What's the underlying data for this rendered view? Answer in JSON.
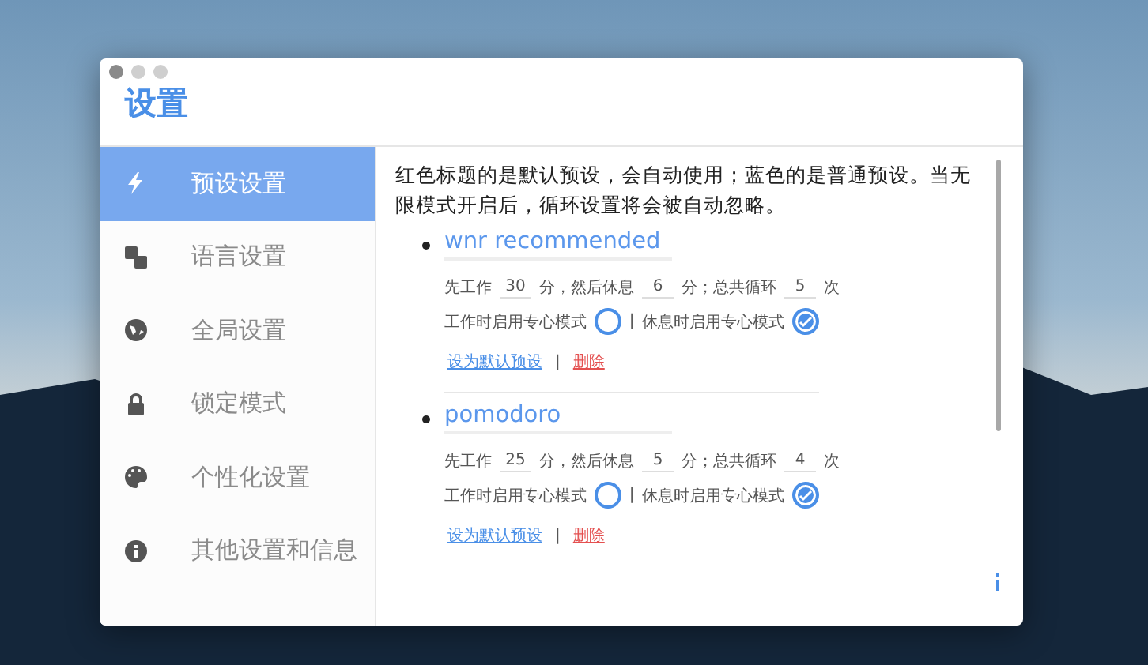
{
  "window": {
    "title": "设置"
  },
  "sidebar": {
    "items": [
      {
        "label": "预设设置",
        "selected": true
      },
      {
        "label": "语言设置",
        "selected": false
      },
      {
        "label": "全局设置",
        "selected": false
      },
      {
        "label": "锁定模式",
        "selected": false
      },
      {
        "label": "个性化设置",
        "selected": false
      },
      {
        "label": "其他设置和信息",
        "selected": false
      }
    ]
  },
  "intro": "红色标题的是默认预设，会自动使用；蓝色的是普通预设。当无限模式开启后，循环设置将会被自动忽略。",
  "presets": [
    {
      "name": "wnr recommended",
      "is_default": false,
      "work_label": "先工作",
      "work": "30",
      "rest_label": "分，然后休息",
      "rest": "6",
      "loops_label": "分；总共循环",
      "loops": "5",
      "end_label": "次",
      "focus_work": {
        "label": "工作时启用专心模式",
        "checked": false
      },
      "divider": "|",
      "focus_rest": {
        "label": "休息时启用专心模式",
        "checked": true
      },
      "set_default": "设为默认预设",
      "link_divider": "|",
      "delete": "删除"
    },
    {
      "name": "pomodoro",
      "is_default": false,
      "work_label": "先工作",
      "work": "25",
      "rest_label": "分，然后休息",
      "rest": "5",
      "loops_label": "分；总共循环",
      "loops": "4",
      "end_label": "次",
      "focus_work": {
        "label": "工作时启用专心模式",
        "checked": false
      },
      "divider": "|",
      "focus_rest": {
        "label": "休息时启用专心模式",
        "checked": true
      },
      "set_default": "设为默认预设",
      "link_divider": "|",
      "delete": "删除"
    }
  ]
}
